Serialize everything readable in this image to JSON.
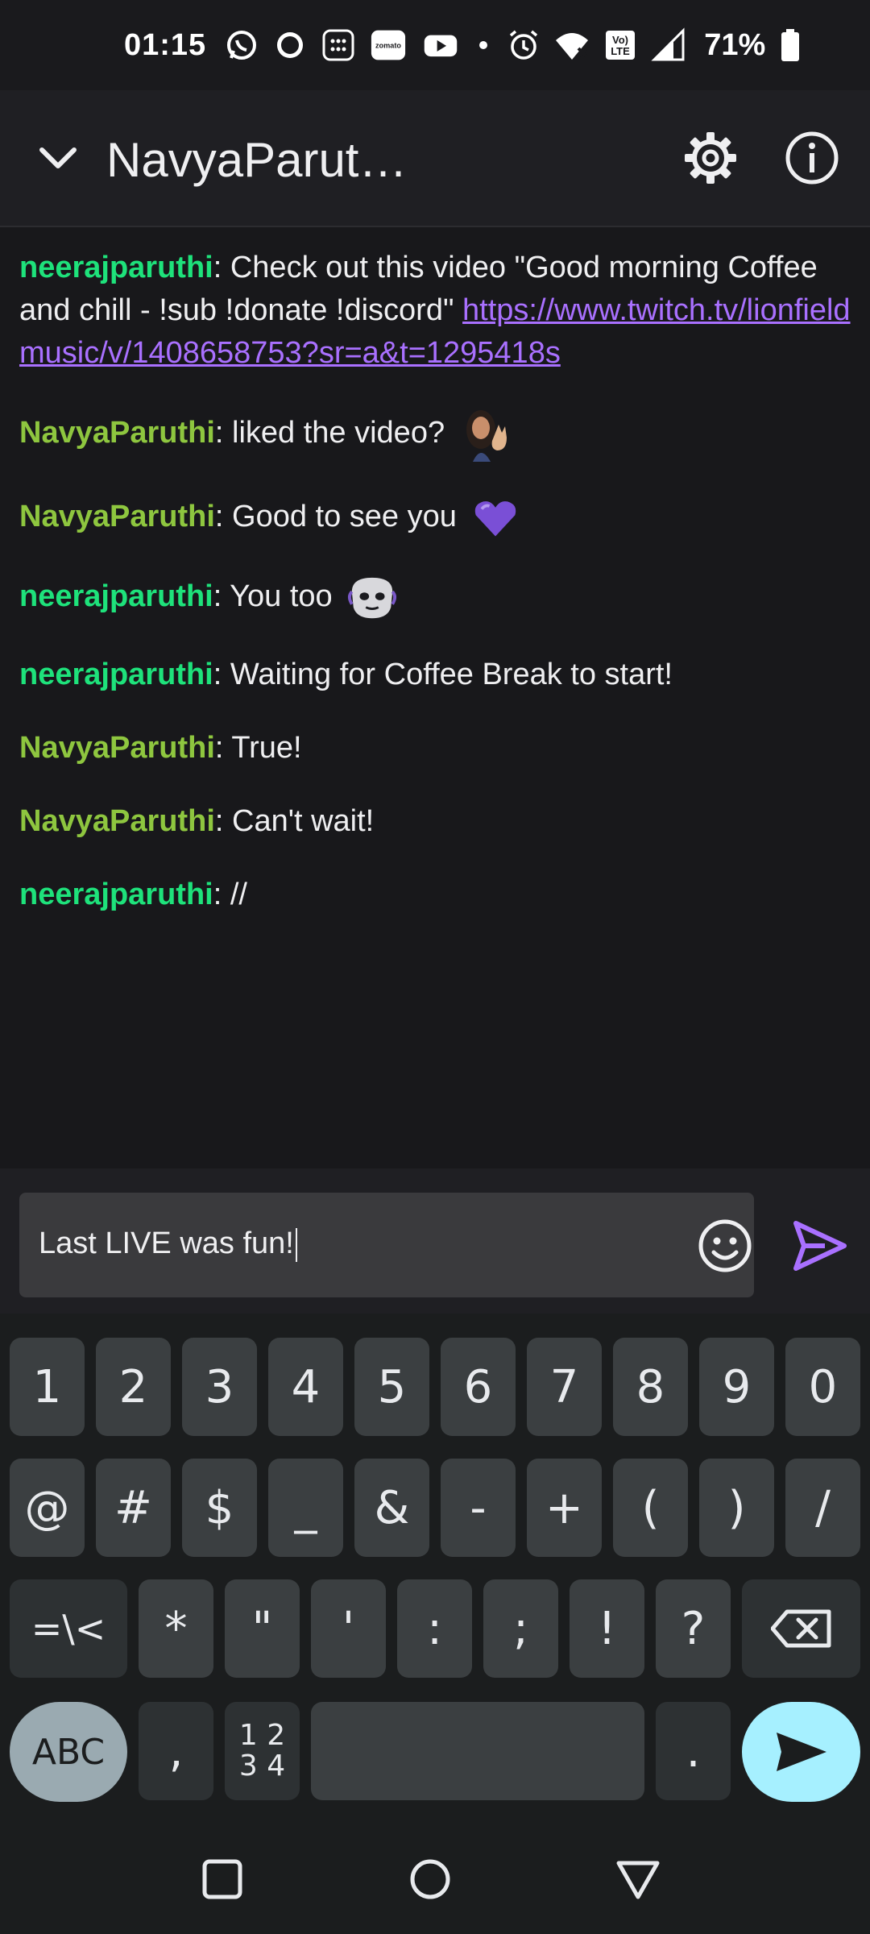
{
  "status_bar": {
    "time": "01:15",
    "battery": "71%",
    "icons": [
      "whatsapp-icon",
      "zee5-icon",
      "calculator-icon",
      "zomato-icon",
      "youtube-icon",
      "dot-icon",
      "alarm-icon",
      "wifi-icon",
      "volte-icon",
      "signal-icon",
      "battery-icon"
    ],
    "zomato_label": "zomato",
    "volte_label": "Vo) LTE"
  },
  "header": {
    "title": "NavyaParut…"
  },
  "chat": {
    "messages": [
      {
        "user": "neerajparuthi",
        "sep": ": ",
        "text": "Check out this video \"Good morning Coffee and chill - !sub !donate !discord\" ",
        "link": "https://www.twitch.tv/lionfieldmusic/v/1408658753?sr=a&t=1295418s"
      },
      {
        "user": "NavyaParuthi",
        "sep": ": ",
        "text": "liked the video?",
        "emote": "waving-woman-emote"
      },
      {
        "user": "NavyaParuthi",
        "sep": ": ",
        "text": "Good to see you",
        "emote": "purple-heart-emote"
      },
      {
        "user": "neerajparuthi",
        "sep": ": ",
        "text": "You too",
        "emote": "robot-face-emote"
      },
      {
        "user": "neerajparuthi",
        "sep": ": ",
        "text": "Waiting for Coffee Break to start!"
      },
      {
        "user": "NavyaParuthi",
        "sep": ": ",
        "text": "True!"
      },
      {
        "user": "NavyaParuthi",
        "sep": ": ",
        "text": "Can't wait!"
      },
      {
        "user": "neerajparuthi",
        "sep": ": ",
        "text": "//"
      }
    ]
  },
  "composer": {
    "value": "Last LIVE was fun!"
  },
  "keyboard": {
    "row1": [
      "1",
      "2",
      "3",
      "4",
      "5",
      "6",
      "7",
      "8",
      "9",
      "0"
    ],
    "row2": [
      "@",
      "#",
      "$",
      "_",
      "&",
      "-",
      "+",
      "(",
      ")",
      "/"
    ],
    "row3": [
      "=\\<",
      "*",
      "\"",
      "'",
      ":",
      ";",
      "!",
      "?"
    ],
    "abc": "ABC",
    "comma": ",",
    "numpad_top": "1 2",
    "numpad_bottom": "3 4",
    "period": "."
  },
  "colors": {
    "accent": "#a970ff",
    "username_green": "#1ee27b",
    "username_lime": "#8ec63f",
    "send_key": "#a6f0ff"
  }
}
